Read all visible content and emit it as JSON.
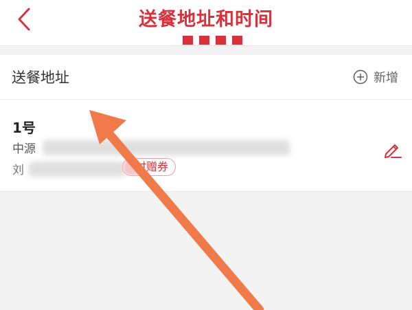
{
  "header": {
    "title": "送餐地址和时间",
    "back_icon": "chevron-left-icon"
  },
  "section": {
    "title": "送餐地址",
    "add_label": "新增",
    "add_icon": "plus-circle-icon"
  },
  "address": {
    "name": "1号",
    "address_prefix": "中源",
    "contact_prefix": "刘",
    "coupon_label": "时赠券",
    "edit_icon": "pencil-icon"
  },
  "colors": {
    "accent": "#d6323c",
    "annotation_arrow": "#f07a4a",
    "background": "#f3f3f3"
  }
}
